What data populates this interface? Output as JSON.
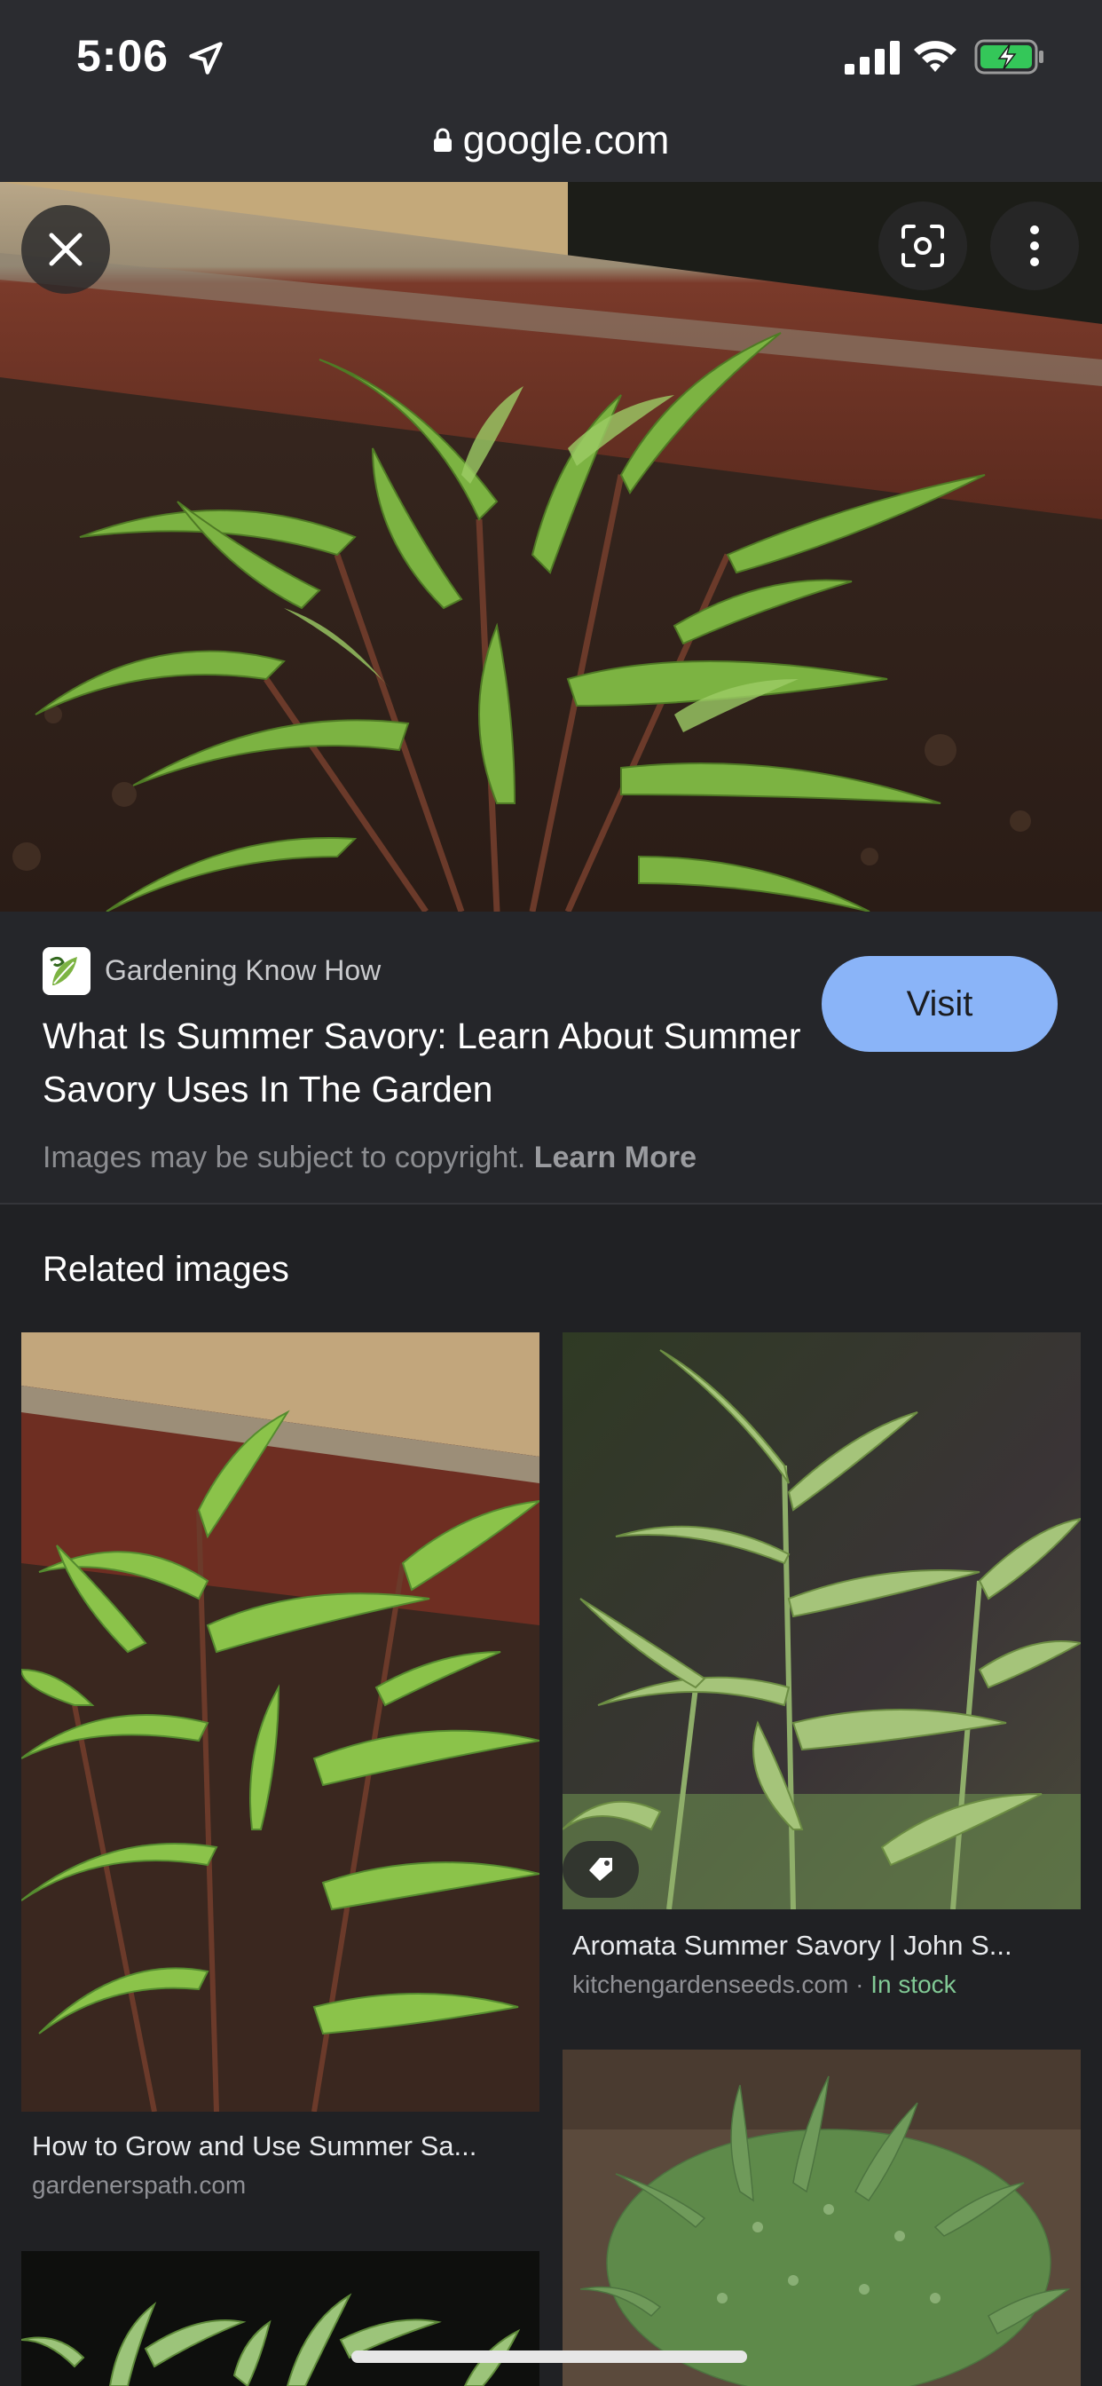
{
  "status_bar": {
    "time": "5:06",
    "icons": [
      "location-arrow-icon",
      "signal-icon",
      "wifi-icon",
      "battery-charging-icon"
    ]
  },
  "browser": {
    "url": "google.com",
    "lock_icon": "lock-icon"
  },
  "viewer": {
    "close_icon": "close-icon",
    "lens_icon": "lens-icon",
    "more_icon": "more-vertical-icon"
  },
  "source": {
    "site_name": "Gardening Know How",
    "title": "What Is Summer Savory: Learn About Summer Savory Uses In The Garden",
    "visit_label": "Visit",
    "copyright_text": "Images may be subject to copyright.",
    "learn_more_label": "Learn More"
  },
  "related": {
    "heading": "Related images",
    "items": [
      {
        "title": "How to Grow and Use Summer Sa...",
        "domain": "gardenerspath.com"
      },
      {
        "title": "Aromata Summer Savory | John S...",
        "domain": "kitchengardenseeds.com",
        "separator": "·",
        "stock": "In stock"
      },
      {
        "title": "",
        "domain": ""
      },
      {
        "title": "",
        "domain": ""
      }
    ]
  },
  "colors": {
    "background": "#202124",
    "accent": "#8ab4f8",
    "in_stock": "#81c995"
  }
}
